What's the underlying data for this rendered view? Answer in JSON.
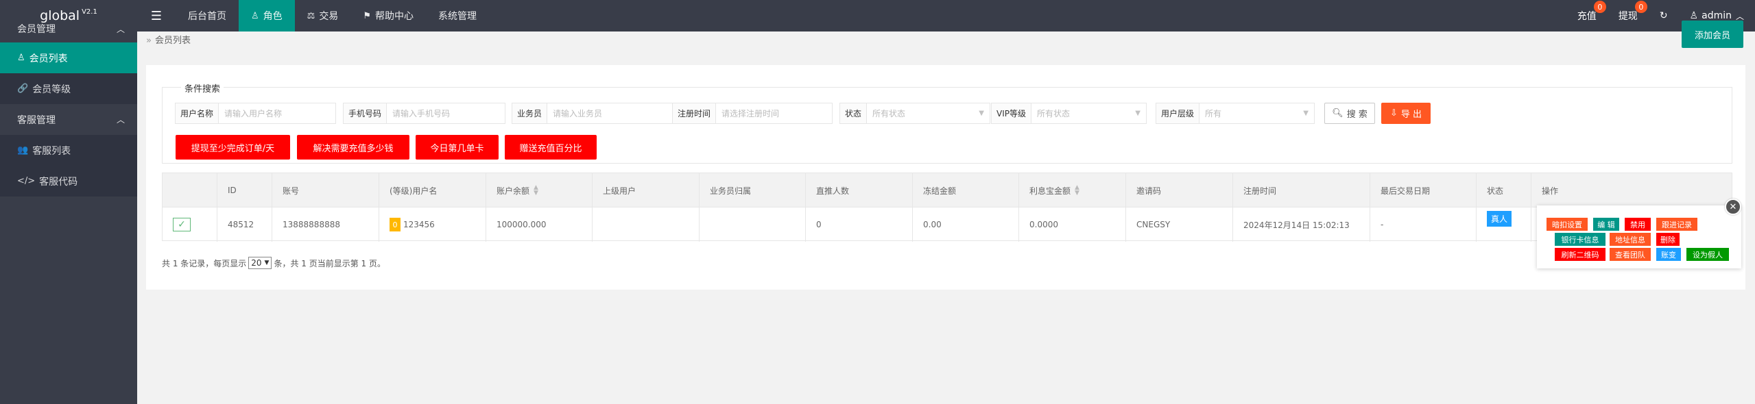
{
  "app": {
    "logo": "global",
    "version": "V2.1"
  },
  "header": {
    "nav": [
      {
        "label": "后台首页",
        "icon": "menu-icon"
      },
      {
        "label": "后台首页"
      },
      {
        "label": "角色",
        "icon": "user-icon",
        "active": true
      },
      {
        "label": "交易",
        "icon": "scale-icon"
      },
      {
        "label": "帮助中心",
        "icon": "flag-icon"
      },
      {
        "label": "系统管理"
      }
    ],
    "recharge": {
      "label": "充值",
      "badge": "0"
    },
    "withdraw": {
      "label": "提现",
      "badge": "0"
    },
    "user": "admin"
  },
  "sidebar": {
    "groups": [
      {
        "label": "会员管理",
        "items": [
          {
            "label": "会员列表",
            "icon": "user-icon",
            "active": true
          },
          {
            "label": "会员等级",
            "icon": "link-icon"
          }
        ]
      },
      {
        "label": "客服管理",
        "items": [
          {
            "label": "客服列表",
            "icon": "users-icon"
          },
          {
            "label": "客服代码",
            "icon": "code-icon"
          }
        ]
      }
    ]
  },
  "breadcrumb": "会员列表",
  "add_button": "添加会员",
  "search": {
    "legend": "条件搜索",
    "fields": [
      {
        "label": "用户名称",
        "placeholder": "请输入用户名称"
      },
      {
        "label": "手机号码",
        "placeholder": "请输入手机号码"
      },
      {
        "label": "业务员",
        "placeholder": "请输入业务员"
      },
      {
        "label": "注册时间",
        "placeholder": "请选择注册时间"
      },
      {
        "label": "状态",
        "placeholder": "所有状态"
      },
      {
        "label": "VIP等级",
        "placeholder": "所有状态"
      },
      {
        "label": "用户层级",
        "placeholder": "所有"
      }
    ],
    "search_btn": "搜 索",
    "export_btn": "导 出"
  },
  "quick_buttons": [
    "提现至少完成订单/天",
    "解决需要充值多少钱",
    "今日第几单卡",
    "赠送充值百分比"
  ],
  "table": {
    "headers": [
      "ID",
      "账号",
      "(等级)用户名",
      "账户余额",
      "上级用户",
      "业务员归属",
      "直推人数",
      "冻结金额",
      "利息宝金额",
      "邀请码",
      "注册时间",
      "最后交易日期",
      "状态",
      "操作"
    ],
    "rows": [
      {
        "id": "48512",
        "account": "13888888888",
        "level": "0",
        "username": "123456",
        "balance": "100000.000",
        "parent": "",
        "salesman": "",
        "direct": "0",
        "frozen": "0.00",
        "interest": "0.0000",
        "invite": "CNEGSY",
        "reg_time": "2024年12月14日 15:02:13",
        "last_trade": "-",
        "status": "真人"
      }
    ]
  },
  "operations": [
    {
      "label": "暗扣设置",
      "color": "#ff5722"
    },
    {
      "label": "编 辑",
      "color": "#009688"
    },
    {
      "label": "禁用",
      "color": "#ff0000"
    },
    {
      "label": "跟进记录",
      "color": "#ff5722"
    },
    {
      "label": "银行卡信息",
      "color": "#009688"
    },
    {
      "label": "地址信息",
      "color": "#ff5722"
    },
    {
      "label": "删除",
      "color": "#ff0000"
    },
    {
      "label": "刷新二维码",
      "color": "#ff0000"
    },
    {
      "label": "查看团队",
      "color": "#ff5722"
    },
    {
      "label": "账变",
      "color": "#1e9fff"
    },
    {
      "label": "设为假人",
      "color": "#009900"
    }
  ],
  "pager": {
    "prefix": "共 1 条记录，每页显示",
    "per_page": "20",
    "suffix": "条，共 1 页当前显示第 1 页。"
  }
}
